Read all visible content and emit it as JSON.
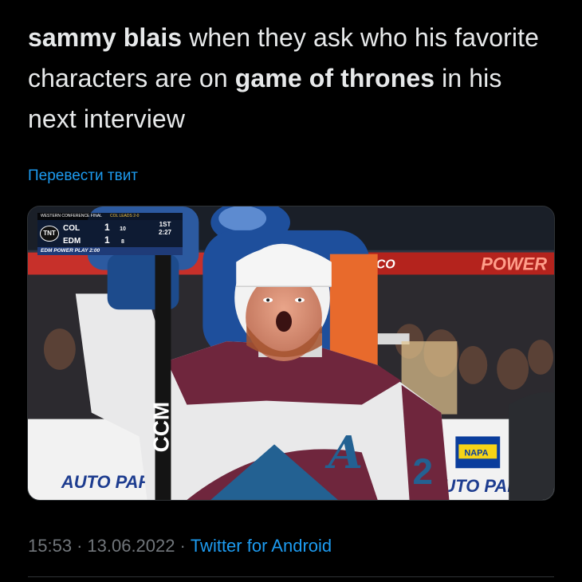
{
  "tweet": {
    "text_parts": [
      {
        "text": "sammy blais",
        "bold": true
      },
      {
        "text": " when they ask who his favorite characters are on ",
        "bold": false
      },
      {
        "text": "game of thrones",
        "bold": true
      },
      {
        "text": " in his next interview",
        "bold": false
      }
    ],
    "translate_label": "Перевести твит"
  },
  "media": {
    "scorebug": {
      "header": "WESTERN CONFERENCE FINAL",
      "series_status": "COL LEADS 2-0",
      "network": "TNT",
      "home": {
        "team": "COL",
        "score": "1",
        "sog": "10"
      },
      "away": {
        "team": "EDM",
        "score": "1",
        "sog": "8"
      },
      "sog_label": "SOG",
      "period": "1ST",
      "clock": "2:27",
      "power_play": "EDM POWER PLAY 2:00"
    },
    "signage": {
      "atco": "ATCO",
      "power": "POWER",
      "auto_parts_left": "AUTO PAR",
      "auto_parts_right": "UTO PAR",
      "napa": "NAPA",
      "stick_brand": "CCM",
      "jersey_letter": "A",
      "jersey_number": "2"
    },
    "colors": {
      "burgundy": "#6f263d",
      "avs_blue": "#236192",
      "oilers_orange": "#ff4c00",
      "oilers_blue": "#041e42"
    }
  },
  "meta": {
    "time": "15:53",
    "date": "13.06.2022",
    "separator": "·",
    "source": "Twitter for Android"
  },
  "accent": "#1d9bf0"
}
